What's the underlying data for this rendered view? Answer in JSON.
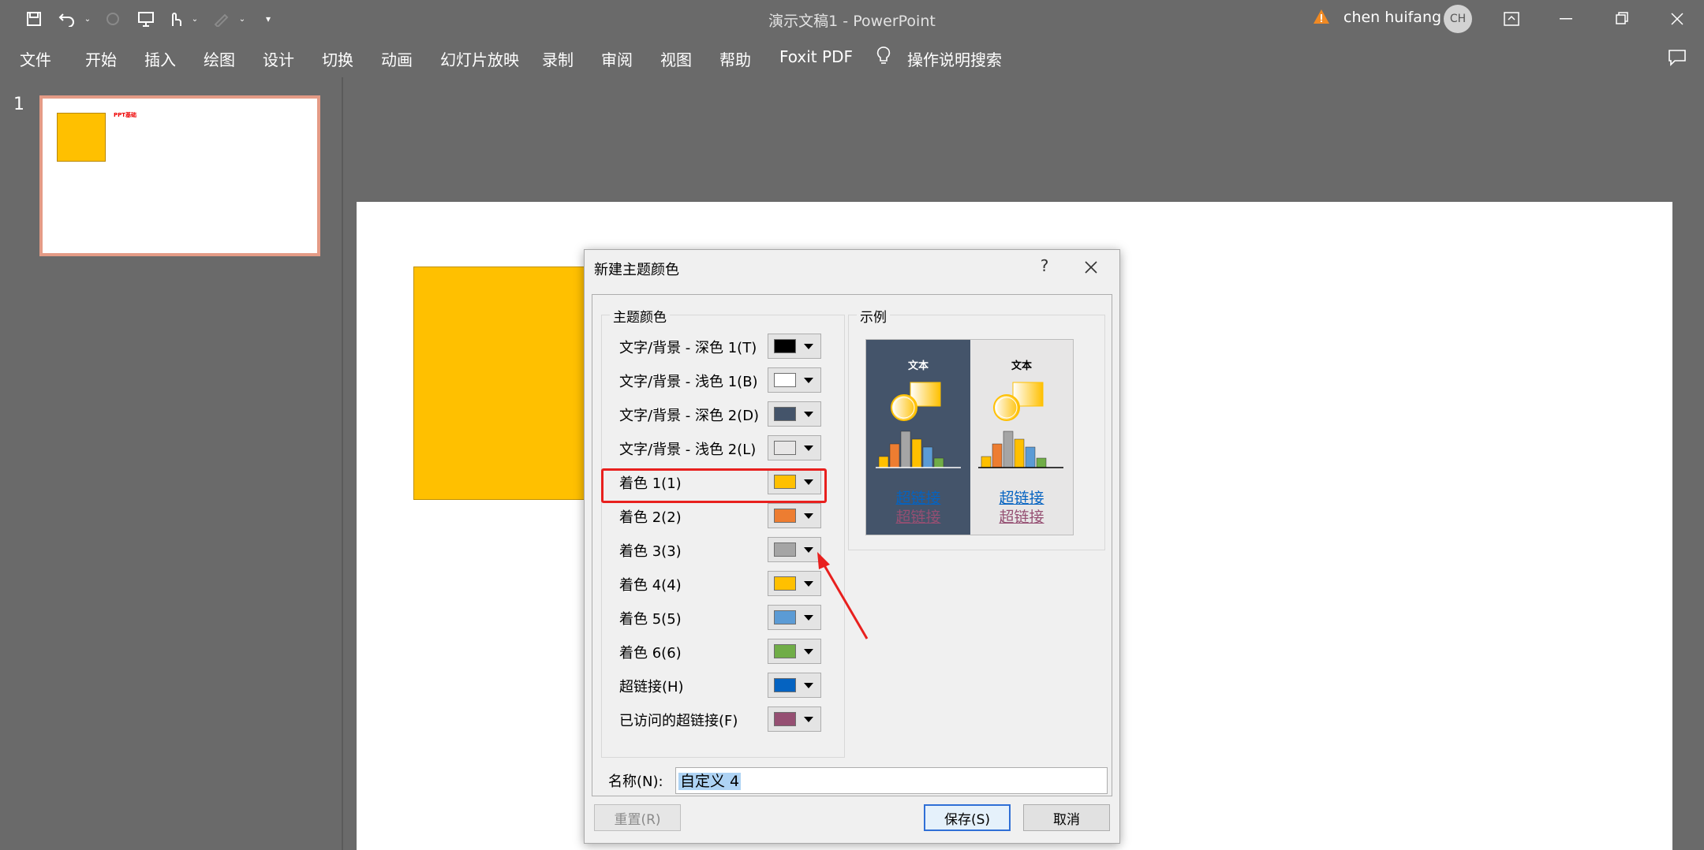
{
  "window": {
    "title": "演示文稿1 - PowerPoint",
    "user_name": "chen huifang",
    "avatar_initials": "CH"
  },
  "menu": [
    "文件",
    "开始",
    "插入",
    "绘图",
    "设计",
    "切换",
    "动画",
    "幻灯片放映",
    "录制",
    "审阅",
    "视图",
    "帮助",
    "Foxit PDF",
    "操作说明搜索"
  ],
  "thumbnails": {
    "slide_number": "1",
    "thumb_title": "PPT基础"
  },
  "dialog": {
    "title": "新建主题颜色",
    "help": "?",
    "group_theme_label": "主题颜色",
    "group_sample_label": "示例",
    "colors": [
      {
        "label": "文字/背景 - 深色 1(T)",
        "color": "#000000"
      },
      {
        "label": "文字/背景 - 浅色 1(B)",
        "color": "#ffffff"
      },
      {
        "label": "文字/背景 - 深色 2(D)",
        "color": "#44546a"
      },
      {
        "label": "文字/背景 - 浅色 2(L)",
        "color": "#e7e6e6"
      },
      {
        "label": "着色 1(1)",
        "color": "#ffc000"
      },
      {
        "label": "着色 2(2)",
        "color": "#ed7d31"
      },
      {
        "label": "着色 3(3)",
        "color": "#a5a5a5"
      },
      {
        "label": "着色 4(4)",
        "color": "#ffc000"
      },
      {
        "label": "着色 5(5)",
        "color": "#5b9bd5"
      },
      {
        "label": "着色 6(6)",
        "color": "#70ad47"
      },
      {
        "label": "超链接(H)",
        "color": "#0563c1"
      },
      {
        "label": "已访问的超链接(F)",
        "color": "#954f72"
      }
    ],
    "preview": {
      "text": "文本",
      "link": "超链接",
      "visited_link": "超链接"
    },
    "name_label": "名称(N):",
    "name_value": "自定义 4",
    "reset_label": "重置(R)",
    "save_label": "保存(S)",
    "cancel_label": "取消"
  }
}
